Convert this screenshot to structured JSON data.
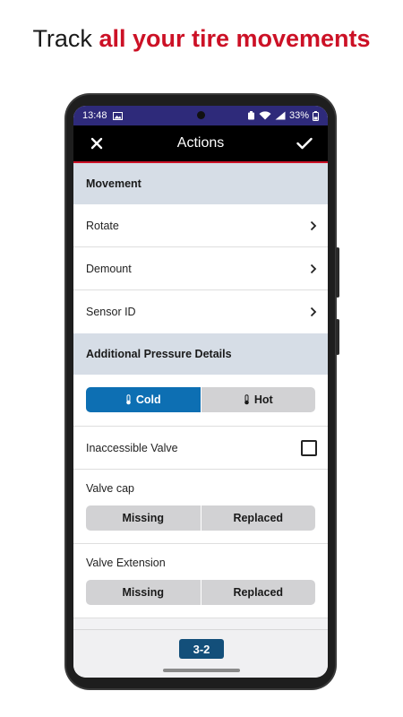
{
  "headline": {
    "plain": "Track ",
    "accent": "all your tire movements"
  },
  "status_bar": {
    "time": "13:48",
    "battery": "33%"
  },
  "app_bar": {
    "title": "Actions"
  },
  "movement": {
    "header": "Movement",
    "items": [
      {
        "label": "Rotate"
      },
      {
        "label": "Demount"
      },
      {
        "label": "Sensor ID"
      }
    ]
  },
  "pressure": {
    "header": "Additional Pressure Details",
    "temperature": {
      "options": [
        "Cold",
        "Hot"
      ],
      "selected": "Cold"
    },
    "inaccessible_valve": {
      "label": "Inaccessible Valve",
      "checked": false
    },
    "valve_cap": {
      "label": "Valve cap",
      "options": [
        "Missing",
        "Replaced"
      ]
    },
    "valve_extension": {
      "label": "Valve Extension",
      "options": [
        "Missing",
        "Replaced"
      ]
    }
  },
  "bottom": {
    "position_badge": "3-2"
  },
  "colors": {
    "accent_red": "#cc1126",
    "primary_blue": "#0d6fb3",
    "section_bg": "#d6dde6",
    "status_bar": "#2e2a7a"
  }
}
